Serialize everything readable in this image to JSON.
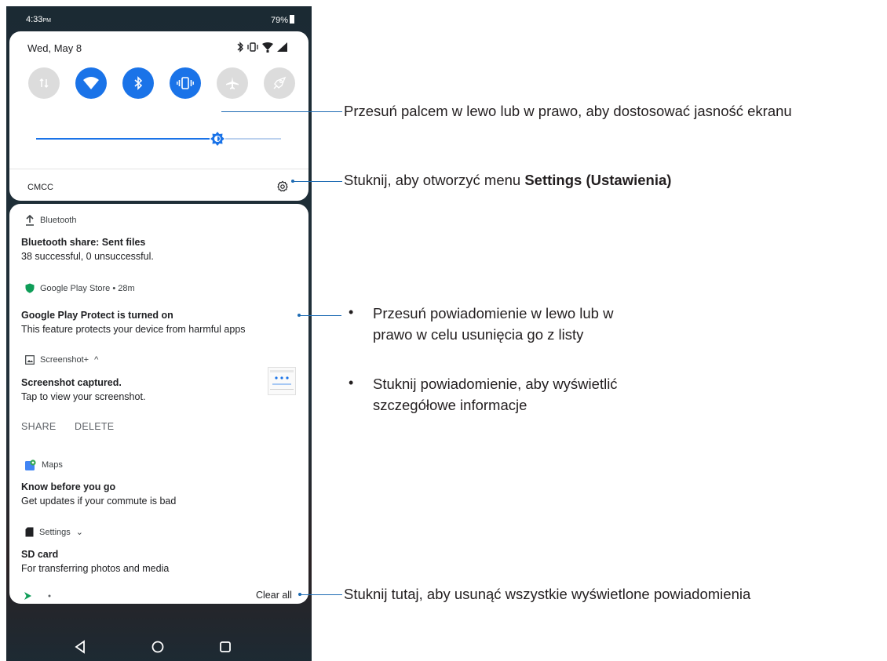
{
  "status_bar": {
    "time": "4:33",
    "time_suffix": "PM",
    "battery": "79%"
  },
  "quick_settings": {
    "date": "Wed, May 8",
    "tiles": [
      {
        "icon": "mobile-data-icon",
        "state": "off"
      },
      {
        "icon": "wifi-icon",
        "state": "on"
      },
      {
        "icon": "bluetooth-icon",
        "state": "on"
      },
      {
        "icon": "vibrate-icon",
        "state": "on"
      },
      {
        "icon": "airplane-mode-icon",
        "state": "off"
      },
      {
        "icon": "game-genie-icon",
        "state": "off"
      }
    ],
    "brightness_level": 0.74,
    "carrier": "CMCC"
  },
  "notifications": {
    "bluetooth": {
      "app": "Bluetooth",
      "title": "Bluetooth share: Sent files",
      "text": "38 successful, 0 unsuccessful."
    },
    "play_store": {
      "app": "Google Play Store • 28m",
      "title": "Google Play Protect is turned on",
      "text": "This feature protects your device from harmful apps"
    },
    "screenshot": {
      "app": "Screenshot+",
      "expand": "^",
      "title": "Screenshot captured.",
      "text": "Tap to view your screenshot.",
      "action_share": "SHARE",
      "action_delete": "DELETE"
    },
    "maps": {
      "app": "Maps",
      "title": "Know before you go",
      "text": "Get updates if your commute is bad"
    },
    "settings": {
      "app": "Settings",
      "expand": "⌄",
      "title": "SD card",
      "text": "For transferring photos and media"
    },
    "clear_all": "Clear all"
  },
  "annotations": {
    "brightness": "Przesuń palcem w lewo lub w prawo, aby dostosować jasność ekranu",
    "settings_prefix": "Stuknij, aby otworzyć menu ",
    "settings_bold": "Settings (Ustawienia)",
    "swipe_line1": "Przesuń powiadomienie w lewo lub w",
    "swipe_line2": "prawo w celu usunięcia go z listy",
    "tap_line1": "Stuknij powiadomienie, aby wyświetlić",
    "tap_line2": "szczegółowe informacje",
    "bullet": "•",
    "clear_all": "Stuknij tutaj, aby usunąć wszystkie wyświetlone powiadomienia"
  },
  "colors": {
    "accent": "#1a73e8",
    "callout": "#1d6bb3",
    "tile_off": "#dcdcdc"
  }
}
